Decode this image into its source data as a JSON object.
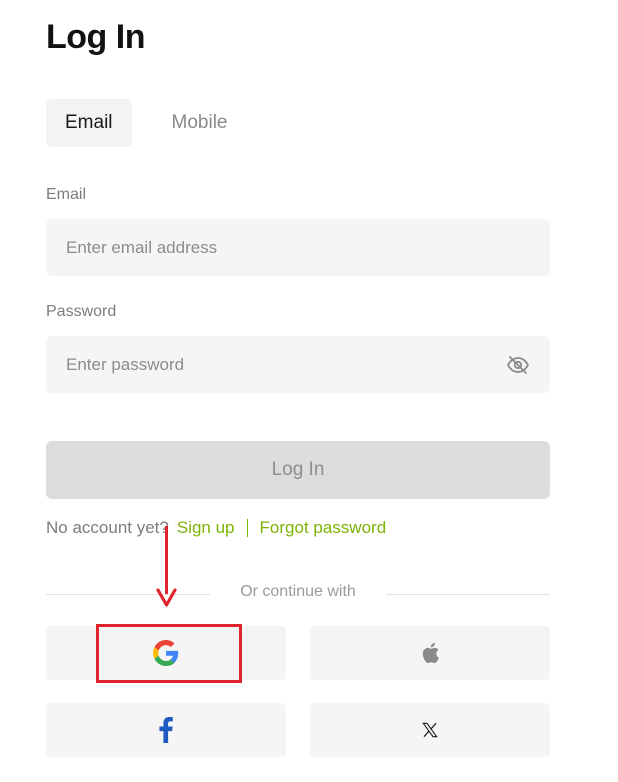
{
  "page": {
    "title": "Log In"
  },
  "tabs": [
    {
      "label": "Email",
      "active": true
    },
    {
      "label": "Mobile",
      "active": false
    }
  ],
  "email": {
    "label": "Email",
    "placeholder": "Enter email address",
    "value": ""
  },
  "password": {
    "label": "Password",
    "placeholder": "Enter password",
    "value": "",
    "toggle_icon": "eye-off-icon"
  },
  "login_button": {
    "label": "Log In"
  },
  "signup": {
    "prompt": "No account yet?",
    "signup_link": "Sign up",
    "forgot_link": "Forgot password"
  },
  "social": {
    "heading": "Or continue with",
    "buttons": [
      {
        "name": "google",
        "icon": "google-icon"
      },
      {
        "name": "apple",
        "icon": "apple-icon"
      },
      {
        "name": "facebook",
        "icon": "facebook-icon"
      },
      {
        "name": "x",
        "icon": "x-icon"
      }
    ]
  },
  "colors": {
    "accent_link": "#7cb305",
    "annotation_red": "#e0242d",
    "field_bg": "#f5f5f6",
    "button_disabled": "#dcdcdc"
  }
}
